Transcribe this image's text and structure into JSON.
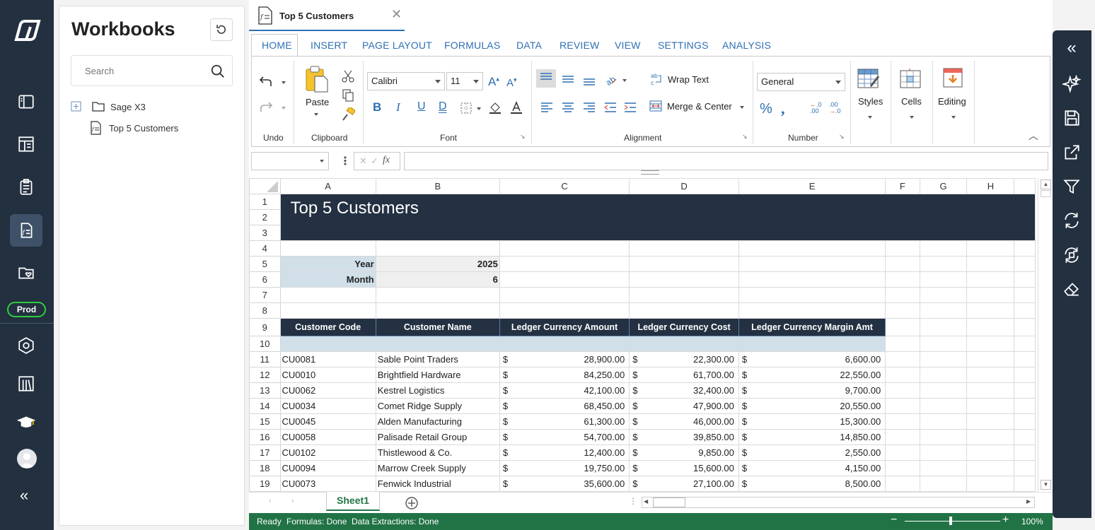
{
  "rail": {
    "env_badge": "Prod"
  },
  "workbooks": {
    "title": "Workbooks",
    "search_placeholder": "Search",
    "tree": [
      {
        "label": "Sage X3"
      },
      {
        "label": "Top 5 Customers"
      }
    ]
  },
  "doc_tab": {
    "label": "Top 5 Customers"
  },
  "ribbon": {
    "tabs": [
      "HOME",
      "INSERT",
      "PAGE LAYOUT",
      "FORMULAS",
      "DATA",
      "REVIEW",
      "VIEW",
      "SETTINGS",
      "ANALYSIS"
    ],
    "groups": {
      "undo": "Undo",
      "clipboard": "Clipboard",
      "font": "Font",
      "alignment": "Alignment",
      "number": "Number"
    },
    "paste": "Paste",
    "font_name": "Calibri",
    "font_size": "11",
    "wrap_text": "Wrap Text",
    "merge_center": "Merge & Center",
    "number_format": "General",
    "styles": "Styles",
    "cells": "Cells",
    "editing": "Editing"
  },
  "sheet": {
    "columns": [
      "A",
      "B",
      "C",
      "D",
      "E",
      "F",
      "G",
      "H"
    ],
    "rows": [
      "1",
      "2",
      "3",
      "4",
      "5",
      "6",
      "7",
      "8",
      "9",
      "10",
      "11",
      "12",
      "13",
      "14",
      "15",
      "16",
      "17",
      "18",
      "19"
    ],
    "title": "Top 5 Customers",
    "params": [
      {
        "label": "Year",
        "value": "2025"
      },
      {
        "label": "Month",
        "value": "6"
      }
    ],
    "headers": [
      "Customer Code",
      "Customer Name",
      "Ledger Currency Amount",
      "Ledger Currency Cost",
      "Ledger Currency Margin Amt"
    ],
    "currency_symbol": "$",
    "data": [
      [
        "CU0081",
        "Sable Point Traders",
        "28,900.00",
        "22,300.00",
        "6,600.00"
      ],
      [
        "CU0010",
        "Brightfield Hardware",
        "84,250.00",
        "61,700.00",
        "22,550.00"
      ],
      [
        "CU0062",
        "Kestrel Logistics",
        "42,100.00",
        "32,400.00",
        "9,700.00"
      ],
      [
        "CU0034",
        "Comet Ridge Supply",
        "68,450.00",
        "47,900.00",
        "20,550.00"
      ],
      [
        "CU0045",
        "Alden Manufacturing",
        "61,300.00",
        "46,000.00",
        "15,300.00"
      ],
      [
        "CU0058",
        "Palisade Retail Group",
        "54,700.00",
        "39,850.00",
        "14,850.00"
      ],
      [
        "CU0102",
        "Thistlewood & Co.",
        "12,400.00",
        "9,850.00",
        "2,550.00"
      ],
      [
        "CU0094",
        "Marrow Creek Supply",
        "19,750.00",
        "15,600.00",
        "4,150.00"
      ],
      [
        "CU0073",
        "Fenwick Industrial",
        "35,600.00",
        "27,100.00",
        "8,500.00"
      ]
    ],
    "sheet_tab": "Sheet1"
  },
  "status": {
    "ready": "Ready",
    "formulas": "Formulas: Done",
    "extractions": "Data Extractions: Done",
    "zoom": "100%"
  }
}
